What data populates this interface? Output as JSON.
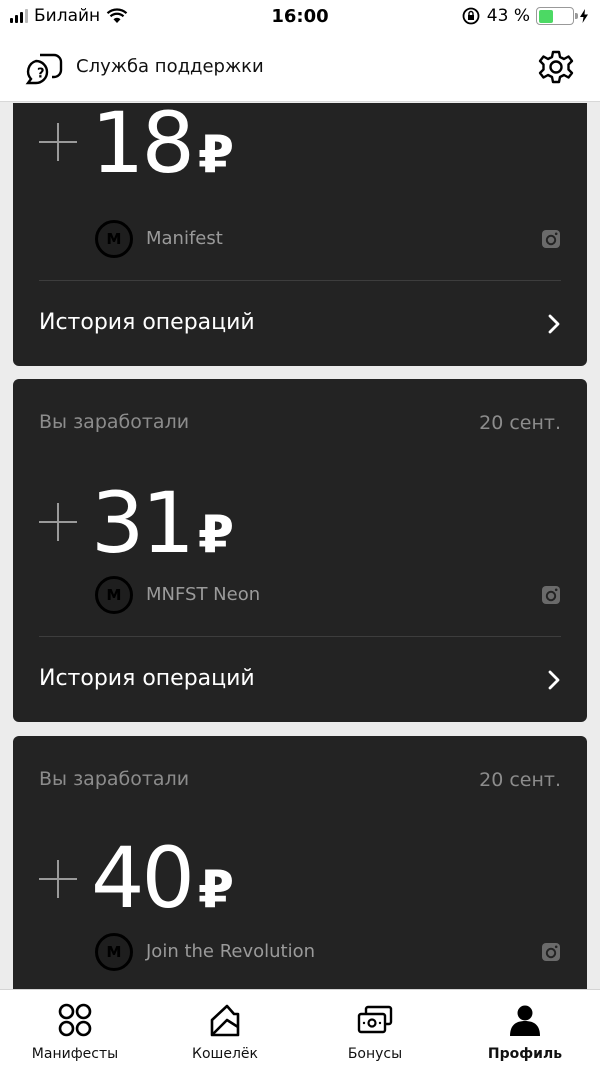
{
  "status_bar": {
    "carrier": "Билайн",
    "time": "16:00",
    "battery_percent": "43 %",
    "battery_level": 0.43
  },
  "header": {
    "support_label": "Служба поддержки",
    "support_icon": "support-chat-icon",
    "settings_icon": "gear-icon"
  },
  "cards": [
    {
      "label": "",
      "date": "",
      "amount": "18",
      "currency": "₽",
      "brand": "Manifest",
      "logo_letter": "M",
      "history": "История операций"
    },
    {
      "label": "Вы заработали",
      "date": "20 сент.",
      "amount": "31",
      "currency": "₽",
      "brand": "MNFST Neon",
      "logo_letter": "M",
      "history": "История операций"
    },
    {
      "label": "Вы заработали",
      "date": "20 сент.",
      "amount": "40",
      "currency": "₽",
      "brand": "Join the Revolution",
      "logo_letter": "M",
      "history": ""
    }
  ],
  "bottom_nav": {
    "items": [
      {
        "label": "Манифесты",
        "icon": "grid-circles-icon",
        "active": false
      },
      {
        "label": "Кошелёк",
        "icon": "wallet-icon",
        "active": false
      },
      {
        "label": "Бонусы",
        "icon": "bonus-cards-icon",
        "active": false
      },
      {
        "label": "Профиль",
        "icon": "profile-icon",
        "active": true
      }
    ]
  },
  "colors": {
    "card_bg": "#232323",
    "battery_green": "#4cd964",
    "muted_text": "#8c8c8c"
  }
}
